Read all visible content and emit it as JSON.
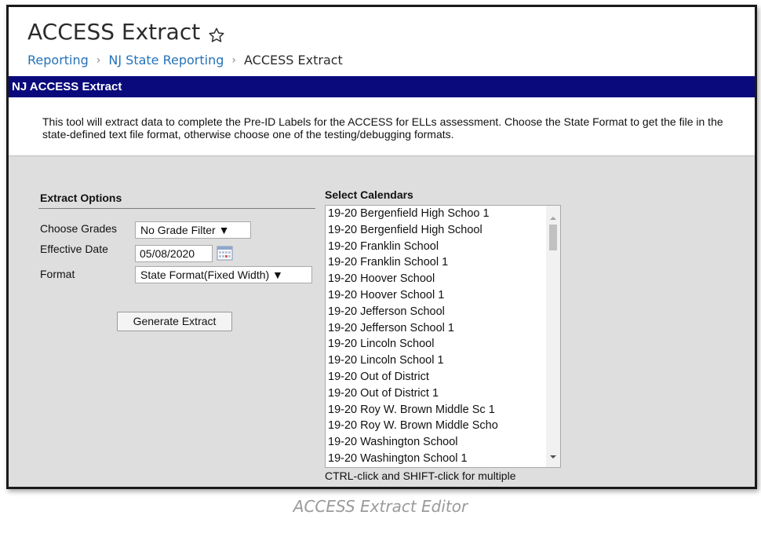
{
  "page": {
    "title": "ACCESS Extract",
    "breadcrumb": [
      "Reporting",
      "NJ State Reporting",
      "ACCESS Extract"
    ],
    "breadcrumb_sep": "›"
  },
  "panel": {
    "header": "NJ ACCESS Extract",
    "description": "This tool will extract data to complete the Pre-ID Labels for the ACCESS for ELLs assessment. Choose the State Format to get the file in the state-defined text file format, otherwise choose one of the testing/debugging formats."
  },
  "extract_options": {
    "heading": "Extract Options",
    "grades_label": "Choose Grades",
    "grades_value": "No Grade Filter ▼",
    "date_label": "Effective Date",
    "date_value": "05/08/2020",
    "format_label": "Format",
    "format_value": "State Format(Fixed Width) ▼",
    "generate_button": "Generate Extract"
  },
  "calendars": {
    "heading": "Select Calendars",
    "items": [
      "19-20 Bergenfield High Schoo 1",
      "19-20 Bergenfield High School",
      "19-20 Franklin School",
      "19-20 Franklin School 1",
      "19-20 Hoover School",
      "19-20 Hoover School 1",
      "19-20 Jefferson School",
      "19-20 Jefferson School 1",
      "19-20 Lincoln School",
      "19-20 Lincoln School 1",
      "19-20 Out of District",
      "19-20 Out of District 1",
      "19-20 Roy W. Brown Middle Sc 1",
      "19-20 Roy W. Brown Middle Scho",
      "19-20 Washington School",
      "19-20 Washington School 1"
    ],
    "hint": "CTRL-click and SHIFT-click for multiple"
  },
  "caption": "ACCESS Extract Editor",
  "colors": {
    "header_bg": "#0a0a7c",
    "link": "#2673b8",
    "panel_bg": "#dedede"
  }
}
